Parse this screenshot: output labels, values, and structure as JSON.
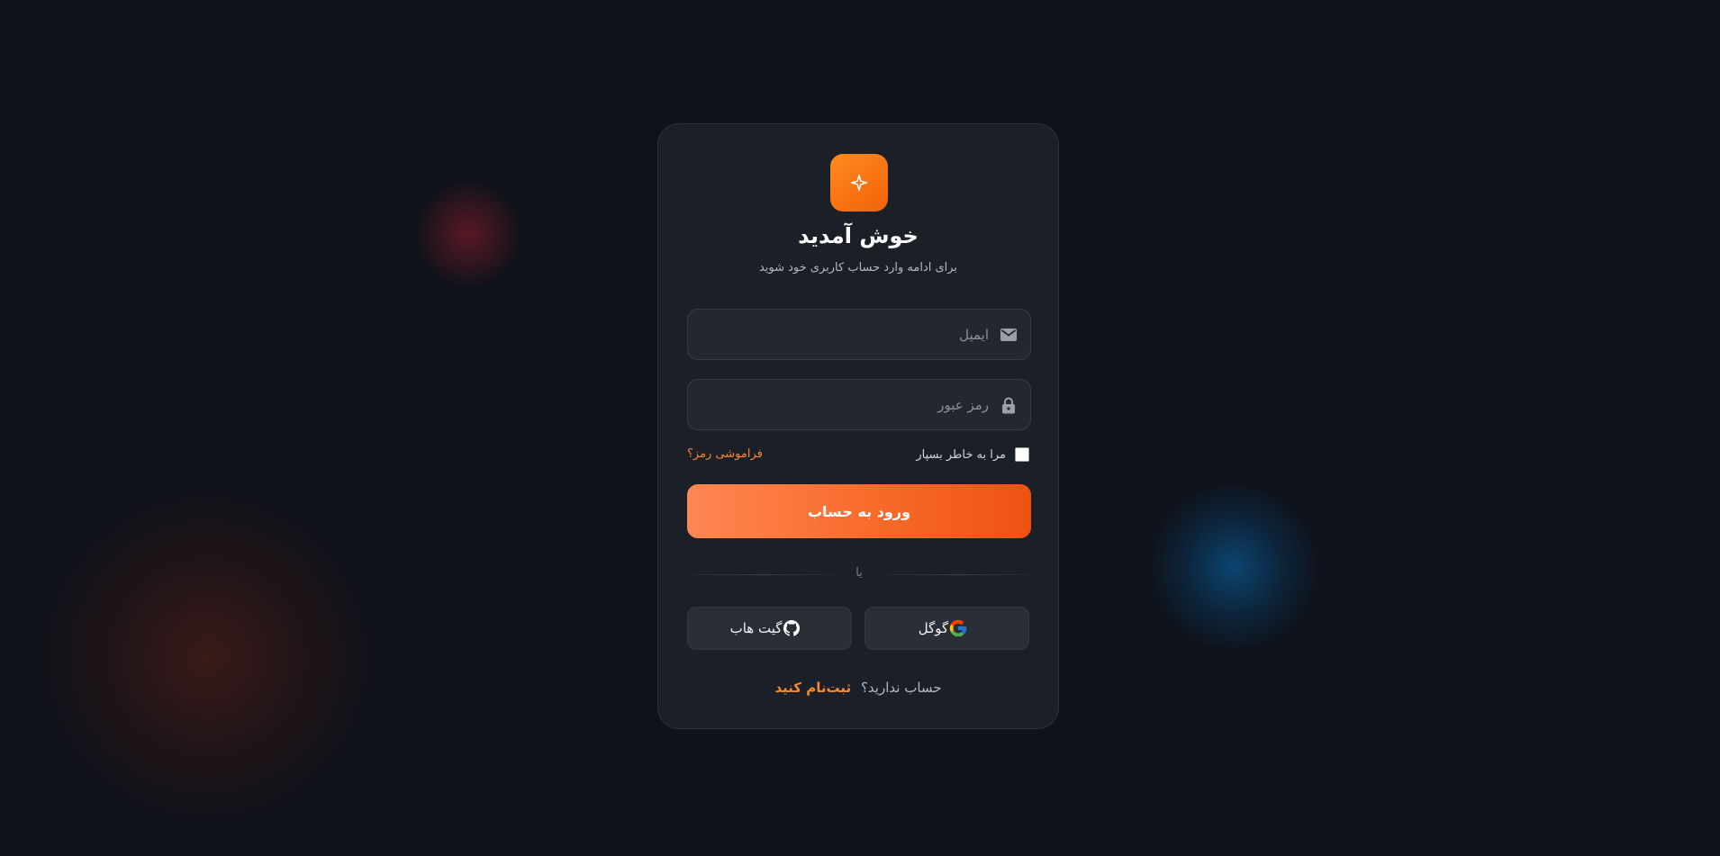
{
  "theme": {
    "background": "#0e121a",
    "card": "#1b1f27",
    "accent": "#f58a2b",
    "button_gradient_start": "#ff8753",
    "button_gradient_end": "#ee5212"
  },
  "logo": {
    "icon": "sparkle-icon"
  },
  "header": {
    "title": "خوش آمدید",
    "subtitle": "برای ادامه وارد حساب کاربری خود شوید"
  },
  "form": {
    "email": {
      "placeholder": "ایمیل",
      "value": "",
      "icon": "mail-icon"
    },
    "password": {
      "placeholder": "رمز عبور",
      "value": "",
      "icon": "lock-icon"
    },
    "remember_label": "مرا به خاطر بسپار",
    "forgot_label": "فراموشی رمز؟",
    "submit_label": "ورود به حساب"
  },
  "divider": {
    "text": "یا"
  },
  "social": {
    "google_label": "گوگل",
    "github_label": "گیت هاب"
  },
  "footer": {
    "question": "حساب ندارید؟",
    "signup_label": "ثبت‌نام کنید"
  }
}
